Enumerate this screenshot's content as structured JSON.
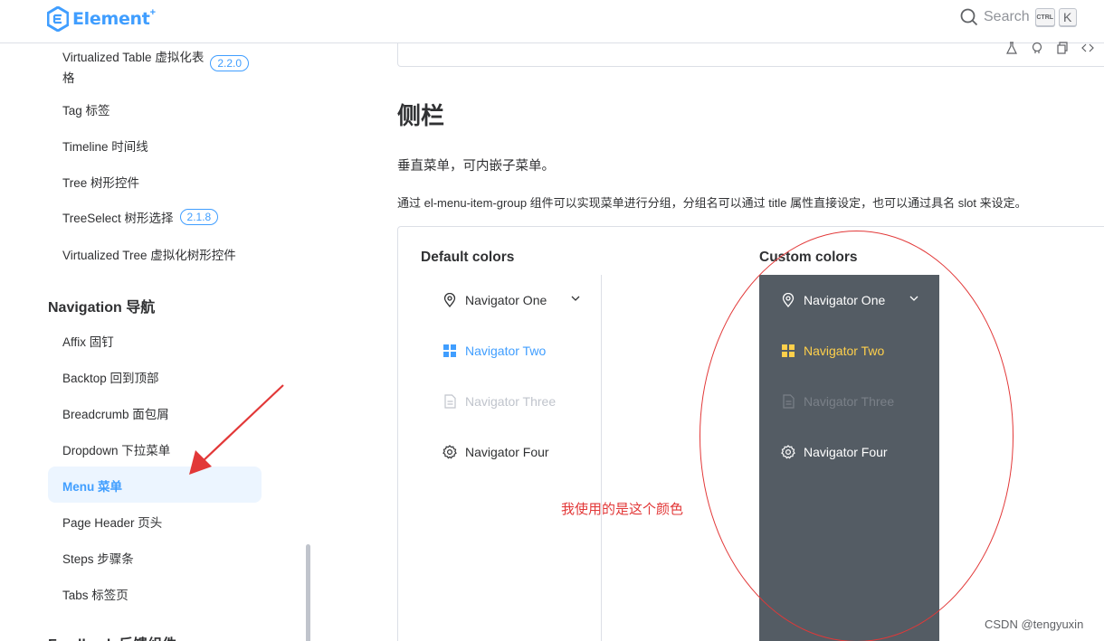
{
  "header": {
    "logo_text": "Element",
    "logo_sup": "+",
    "search_label": "Search",
    "kbd_ctrl": "CTRL",
    "kbd_k": "K"
  },
  "sidebar": {
    "items": [
      {
        "label": "Virtualized Table 虚拟化表",
        "label2": "格",
        "badge": "2.2.0"
      },
      {
        "label": "Tag 标签"
      },
      {
        "label": "Timeline 时间线"
      },
      {
        "label": "Tree 树形控件"
      },
      {
        "label": "TreeSelect 树形选择",
        "badge": "2.1.8"
      },
      {
        "label": "Virtualized Tree 虚拟化树形控件"
      }
    ],
    "group_nav": "Navigation 导航",
    "nav_items": [
      {
        "label": "Affix 固钉"
      },
      {
        "label": "Backtop 回到顶部"
      },
      {
        "label": "Breadcrumb 面包屑"
      },
      {
        "label": "Dropdown 下拉菜单"
      },
      {
        "label": "Menu 菜单"
      },
      {
        "label": "Page Header 页头"
      },
      {
        "label": "Steps 步骤条"
      },
      {
        "label": "Tabs 标签页"
      }
    ],
    "group_feedback": "Feedback 反馈组件",
    "active_color": "#409eff"
  },
  "main": {
    "title": "侧栏",
    "para1": "垂直菜单，可内嵌子菜单。",
    "para2": "通过 el-menu-item-group 组件可以实现菜单进行分组，分组名可以通过 title 属性直接设定，也可以通过具名 slot 来设定。",
    "default_title": "Default colors",
    "custom_title": "Custom colors",
    "menu": [
      {
        "label": "Navigator One",
        "icon": "location-icon"
      },
      {
        "label": "Navigator Two",
        "icon": "menu-grid-icon"
      },
      {
        "label": "Navigator Three",
        "icon": "document-icon"
      },
      {
        "label": "Navigator Four",
        "icon": "setting-icon"
      }
    ],
    "colors": {
      "default_active": "#409eff",
      "custom_bg": "#545c64",
      "custom_active": "#ffd04b",
      "disabled": "#c0c4cc"
    }
  },
  "annotation": {
    "text": "我使用的是这个颜色",
    "color": "#e23838"
  },
  "watermark": "CSDN @tengyuxin"
}
